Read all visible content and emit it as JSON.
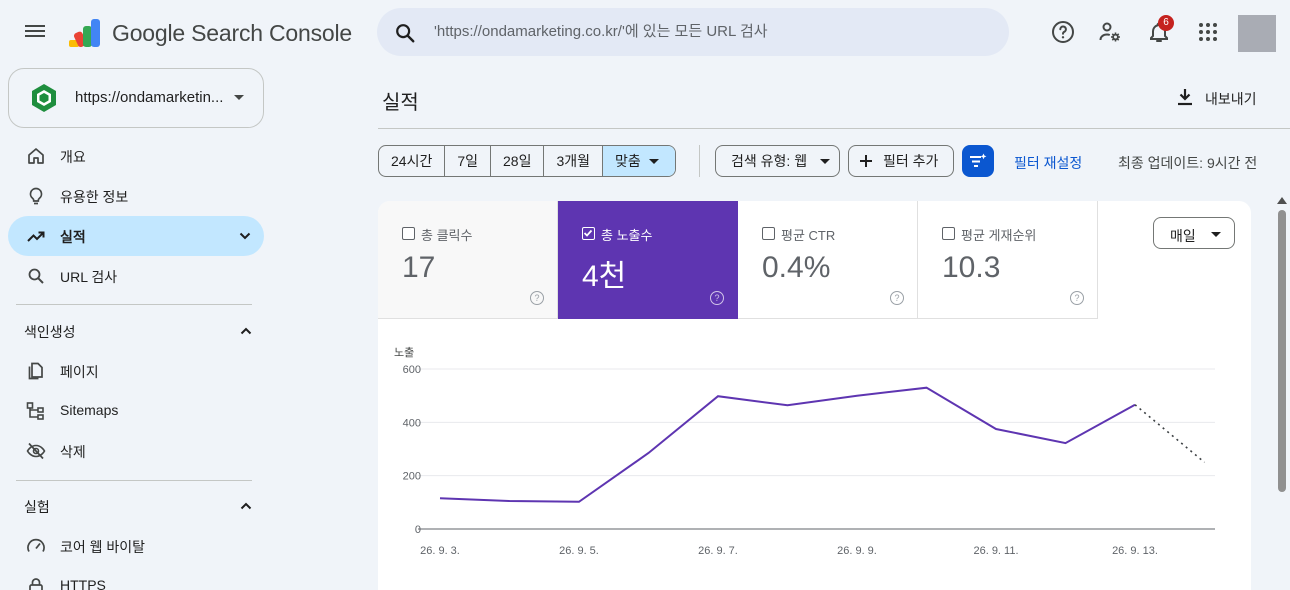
{
  "header": {
    "app_name": "Google Search Console",
    "search_placeholder": "'https://ondamarketing.co.kr/'에 있는 모든 URL 검사",
    "notification_count": "6"
  },
  "sidebar": {
    "property": "https://ondamarketin...",
    "nav": [
      {
        "label": "개요",
        "icon": "home-icon"
      },
      {
        "label": "유용한 정보",
        "icon": "lightbulb-icon"
      },
      {
        "label": "실적",
        "icon": "trending-up-icon"
      },
      {
        "label": "URL 검사",
        "icon": "search-icon"
      }
    ],
    "indexing": {
      "title": "색인생성",
      "items": [
        {
          "label": "페이지",
          "icon": "pages-icon"
        },
        {
          "label": "Sitemaps",
          "icon": "sitemap-icon"
        },
        {
          "label": "삭제",
          "icon": "visibility-off-icon"
        }
      ]
    },
    "experience": {
      "title": "실험",
      "items": [
        {
          "label": "코어 웹 바이탈",
          "icon": "speed-icon"
        },
        {
          "label": "HTTPS",
          "icon": "lock-icon"
        }
      ]
    }
  },
  "main": {
    "title": "실적",
    "export_label": "내보내기",
    "date_ranges": [
      "24시간",
      "7일",
      "28일",
      "3개월",
      "맞춤"
    ],
    "search_type": "검색 유형: 웹",
    "add_filter": "필터 추가",
    "reset_filters": "필터 재설정",
    "last_updated": "최종 업데이트: 9시간 전",
    "granularity": "매일",
    "metrics": [
      {
        "label": "총 클릭수",
        "value": "17",
        "checked": false
      },
      {
        "label": "총 노출수",
        "value": "4천",
        "checked": true
      },
      {
        "label": "평균 CTR",
        "value": "0.4%",
        "checked": false
      },
      {
        "label": "평균 게재순위",
        "value": "10.3",
        "checked": false
      }
    ],
    "help_glyph": "?"
  },
  "colors": {
    "accent": "#5e35b1",
    "link": "#0b57d0",
    "selected_bg": "#c2e7ff"
  },
  "chart_data": {
    "type": "line",
    "ylabel": "노출",
    "ylim": [
      0,
      600
    ],
    "yticks": [
      "0",
      "200",
      "400",
      "600"
    ],
    "x_ticks": [
      "26. 9. 3.",
      "26. 9. 5.",
      "26. 9. 7.",
      "26. 9. 9.",
      "26. 9. 11.",
      "26. 9. 13."
    ],
    "x": [
      "26. 9. 3.",
      "26. 9. 4.",
      "26. 9. 5.",
      "26. 9. 6.",
      "26. 9. 7.",
      "26. 9. 8.",
      "26. 9. 9.",
      "26. 9. 10.",
      "26. 9. 11.",
      "26. 9. 12.",
      "26. 9. 13.",
      "26. 9. 14."
    ],
    "series": [
      {
        "values": [
          115,
          105,
          102,
          285,
          498,
          464,
          500,
          530,
          375,
          322,
          466,
          250
        ],
        "partial_last": true
      }
    ],
    "grid": true
  }
}
